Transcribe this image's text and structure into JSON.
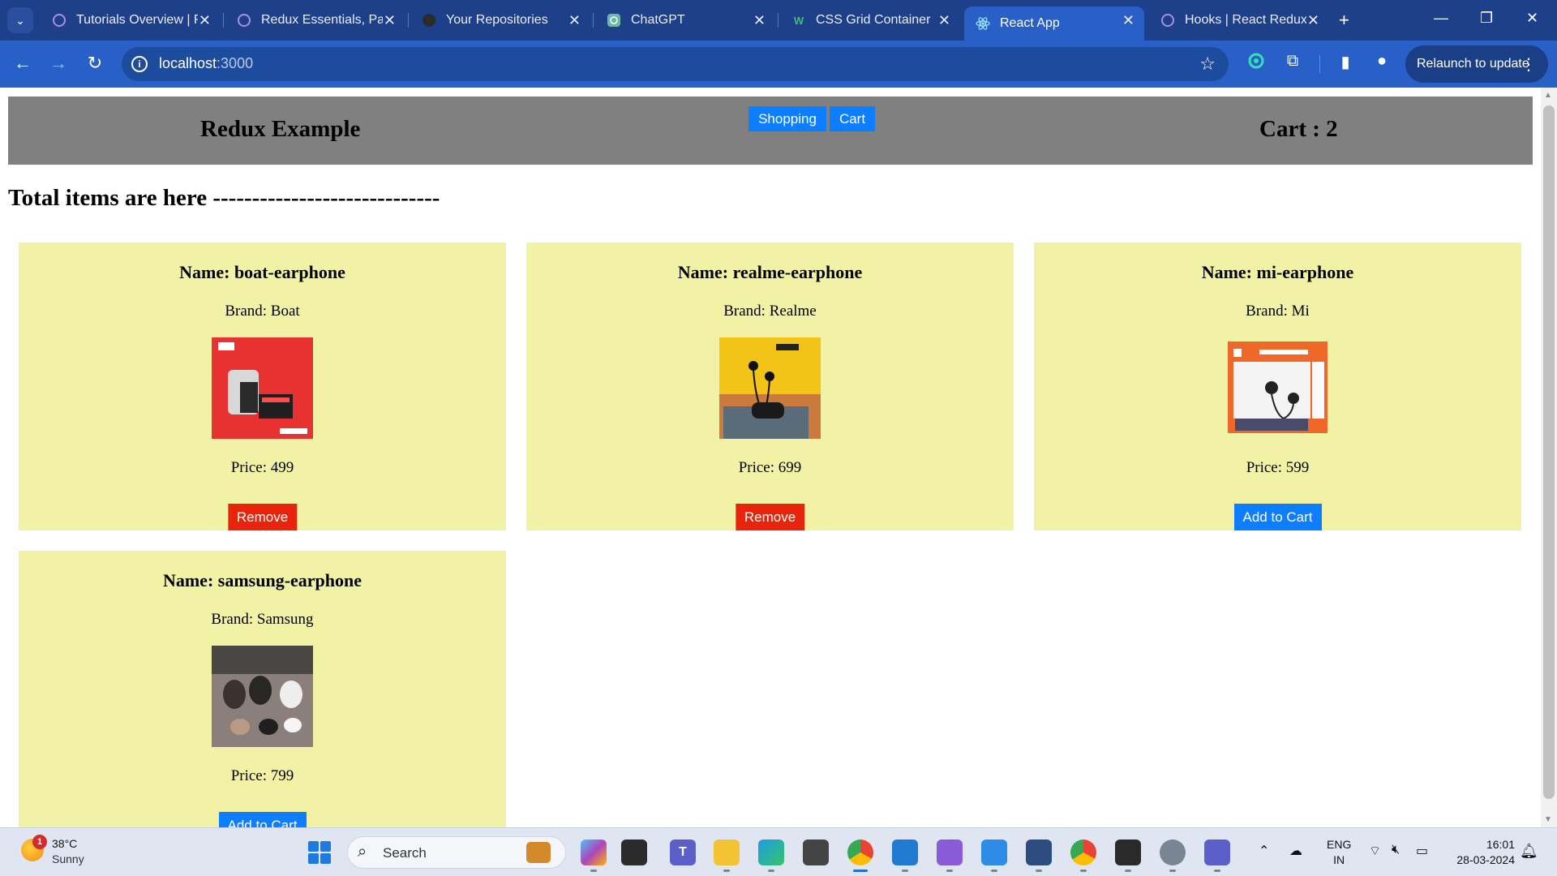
{
  "browser": {
    "tabs": [
      {
        "label": "Tutorials Overview | Redux",
        "icon": "redux-icon",
        "active": false
      },
      {
        "label": "Redux Essentials, Part",
        "icon": "redux-icon",
        "active": false
      },
      {
        "label": "Your Repositories",
        "icon": "github-icon",
        "active": false
      },
      {
        "label": "ChatGPT",
        "icon": "chatgpt-icon",
        "active": false
      },
      {
        "label": "CSS Grid Container",
        "icon": "w3schools-icon",
        "active": false
      },
      {
        "label": "React App",
        "icon": "react-icon",
        "active": true
      },
      {
        "label": "Hooks | React Redux",
        "icon": "redux-icon",
        "active": false
      }
    ],
    "url_host": "localhost",
    "url_port": ":3000",
    "relaunch_label": "Relaunch to update"
  },
  "app": {
    "title": "Redux Example",
    "nav": {
      "shopping": "Shopping",
      "cart": "Cart"
    },
    "cart_label": "Cart : 2",
    "total_heading": "Total items are here -----------------------------"
  },
  "products": [
    {
      "name": "Name: boat-earphone",
      "brand": "Brand: Boat",
      "price": "Price: 499",
      "action": "Remove",
      "in_cart": true,
      "image": "boat-earphone-box"
    },
    {
      "name": "Name: realme-earphone",
      "brand": "Brand: Realme",
      "price": "Price: 699",
      "action": "Remove",
      "in_cart": true,
      "image": "realme-earphone-box"
    },
    {
      "name": "Name: mi-earphone",
      "brand": "Brand: Mi",
      "price": "Price: 599",
      "action": "Add to Cart",
      "in_cart": false,
      "image": "mi-earphone-box"
    },
    {
      "name": "Name: samsung-earphone",
      "brand": "Brand: Samsung",
      "price": "Price: 799",
      "action": "Add to Cart",
      "in_cart": false,
      "image": "samsung-earbuds"
    }
  ],
  "colors": {
    "header_bg": "#808080",
    "card_bg": "#f2f2a6",
    "primary_button": "#0d7eff",
    "remove_button": "#e8250c"
  },
  "taskbar": {
    "weather_badge": "1",
    "weather_temp": "38°C",
    "weather_condition": "Sunny",
    "search_placeholder": "Search",
    "lang_top": "ENG",
    "lang_bottom": "IN",
    "time": "16:01",
    "date": "28-03-2024"
  }
}
